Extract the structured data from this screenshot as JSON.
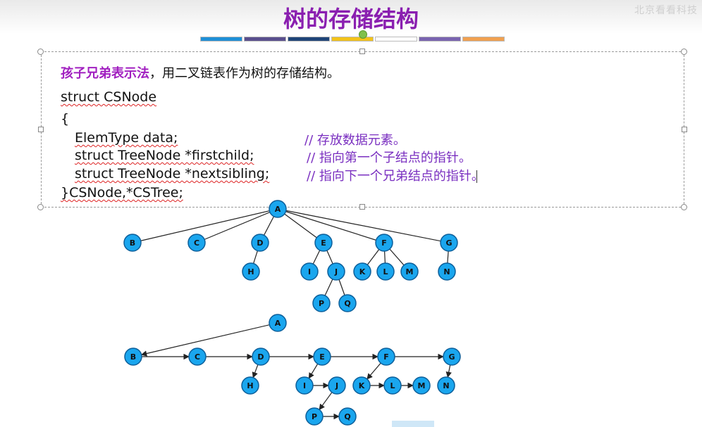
{
  "slide": {
    "title": "树的存储结构",
    "watermark": "北京看看科技",
    "color_bar": [
      "#1f8fd6",
      "#5a4f8e",
      "#1f4478",
      "#f2c21a",
      "#ffffff",
      "#7a64b0",
      "#f0a050"
    ]
  },
  "intro": {
    "keyword": "孩子兄弟表示法",
    "rest": "，用二叉链表作为树的存储结构。"
  },
  "code": {
    "line1": "struct CSNode",
    "line2": "{",
    "line3": "ElemType data;",
    "line4": "struct TreeNode *firstchild;",
    "line5": "struct TreeNode *nextsibling;",
    "line6": "}CSNode,*CSTree;",
    "comment3": "// 存放数据元素。",
    "comment4": "// 指向第一个子结点的指针。",
    "comment5": "// 指向下一个兄弟结点的指针。"
  },
  "colors": {
    "node_fill": "#1aa6ee",
    "title": "#8a1fb0",
    "comment": "#7a2fc0"
  },
  "tree1": {
    "nodes": [
      "A",
      "B",
      "C",
      "D",
      "E",
      "F",
      "G",
      "H",
      "I",
      "J",
      "K",
      "L",
      "M",
      "N",
      "P",
      "Q"
    ],
    "edges": [
      [
        "A",
        "B"
      ],
      [
        "A",
        "C"
      ],
      [
        "A",
        "D"
      ],
      [
        "A",
        "E"
      ],
      [
        "A",
        "F"
      ],
      [
        "A",
        "G"
      ],
      [
        "D",
        "H"
      ],
      [
        "E",
        "I"
      ],
      [
        "E",
        "J"
      ],
      [
        "F",
        "K"
      ],
      [
        "F",
        "L"
      ],
      [
        "F",
        "M"
      ],
      [
        "G",
        "N"
      ],
      [
        "J",
        "P"
      ],
      [
        "J",
        "Q"
      ]
    ]
  },
  "tree2": {
    "nodes": [
      "A",
      "B",
      "C",
      "D",
      "E",
      "F",
      "G",
      "H",
      "I",
      "J",
      "K",
      "L",
      "M",
      "N",
      "P",
      "Q"
    ],
    "firstchild": [
      [
        "A",
        "B"
      ],
      [
        "D",
        "H"
      ],
      [
        "E",
        "I"
      ],
      [
        "F",
        "K"
      ],
      [
        "G",
        "N"
      ],
      [
        "J",
        "P"
      ]
    ],
    "nextsibling": [
      [
        "B",
        "C"
      ],
      [
        "C",
        "D"
      ],
      [
        "D",
        "E"
      ],
      [
        "E",
        "F"
      ],
      [
        "F",
        "G"
      ],
      [
        "I",
        "J"
      ],
      [
        "K",
        "L"
      ],
      [
        "L",
        "M"
      ],
      [
        "P",
        "Q"
      ]
    ]
  }
}
